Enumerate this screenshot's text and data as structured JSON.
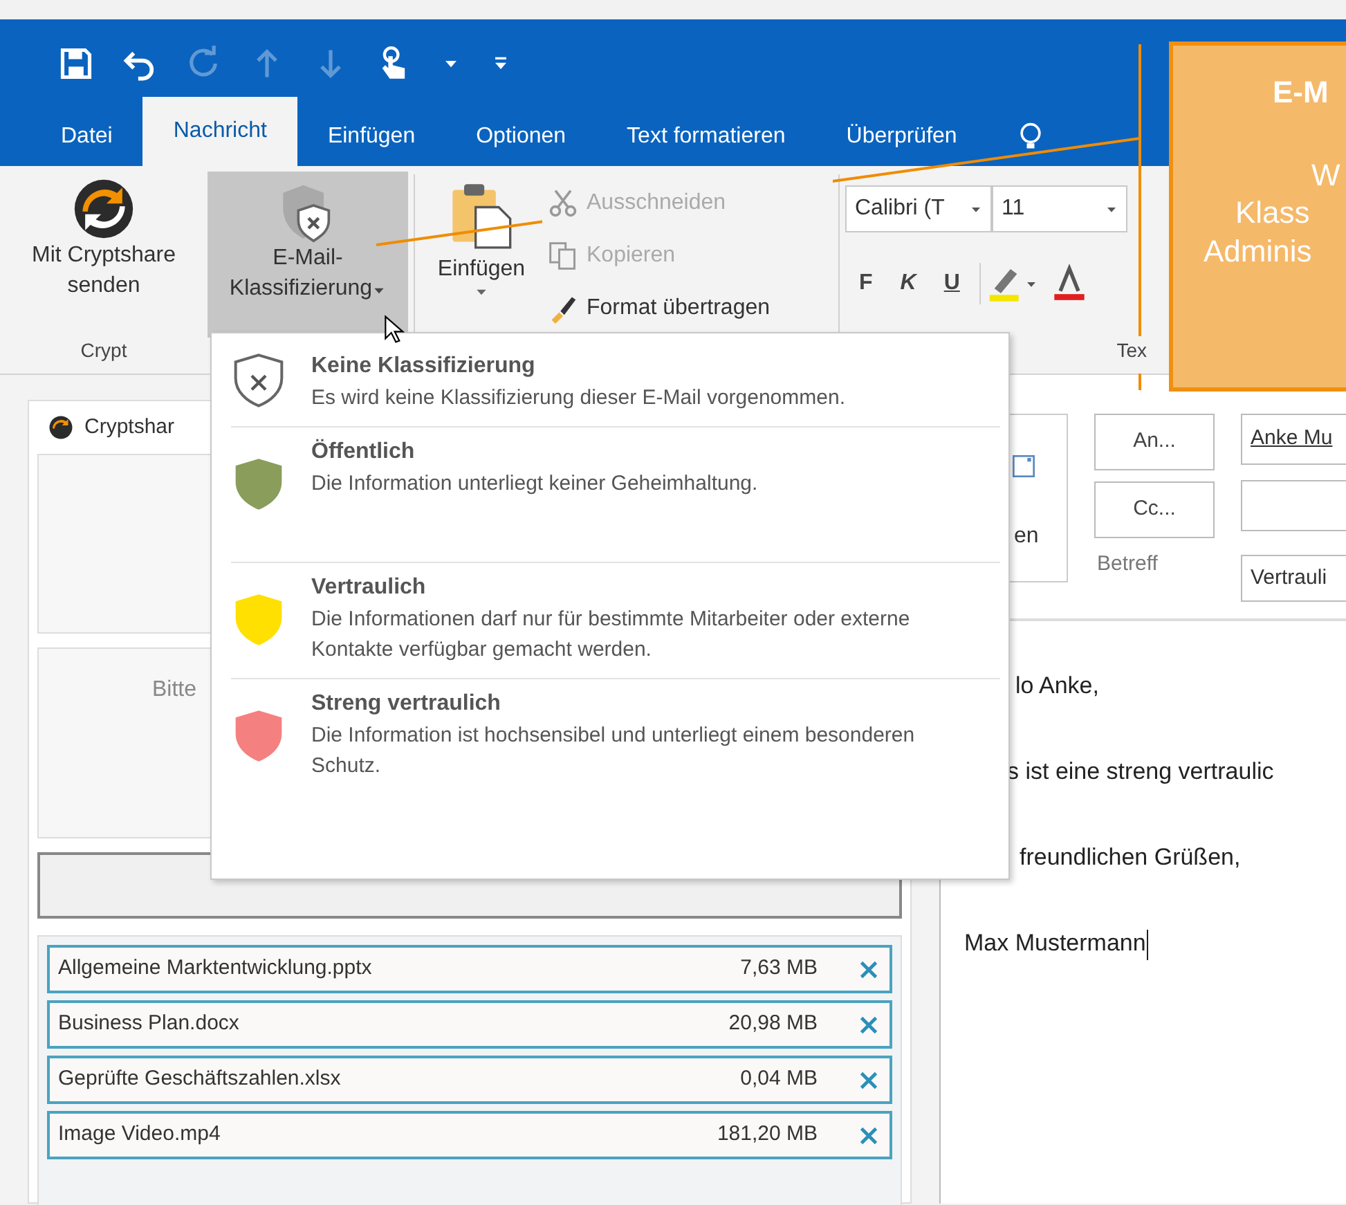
{
  "quick_access": [
    {
      "kind": "save",
      "disabled": false
    },
    {
      "kind": "undo",
      "disabled": false
    },
    {
      "kind": "redo",
      "disabled": true
    },
    {
      "kind": "up",
      "disabled": true
    },
    {
      "kind": "down",
      "disabled": true
    },
    {
      "kind": "touch",
      "disabled": false
    },
    {
      "kind": "caret",
      "disabled": false
    },
    {
      "kind": "customize",
      "disabled": false
    }
  ],
  "tabs": [
    {
      "label": "Datei",
      "selected": false
    },
    {
      "label": "Nachricht",
      "selected": true
    },
    {
      "label": "Einfügen",
      "selected": false
    },
    {
      "label": "Optionen",
      "selected": false
    },
    {
      "label": "Text formatieren",
      "selected": false
    },
    {
      "label": "Überprüfen",
      "selected": false
    }
  ],
  "ribbon": {
    "cryptshare_group": {
      "button_lines": [
        "Mit Cryptshare",
        "senden"
      ],
      "group_label": "Crypt"
    },
    "classification_button": {
      "lines": [
        "E-Mail-",
        "Klassifizierung"
      ],
      "pressed": true
    },
    "paste_button": {
      "label": "Einfügen"
    },
    "clipboard_actions": [
      {
        "kind": "cut",
        "label": "Ausschneiden",
        "disabled": true
      },
      {
        "kind": "copy",
        "label": "Kopieren",
        "disabled": true
      },
      {
        "kind": "brush",
        "label": "Format übertragen",
        "disabled": false
      }
    ],
    "font": {
      "family": "Calibri (T",
      "size": "11",
      "style_buttons": [
        "F",
        "K",
        "U"
      ],
      "group_label": "Tex"
    }
  },
  "cryptshare_panel": {
    "title": "Cryptshar",
    "drop_hint": "Bitte",
    "files": [
      {
        "name": "Allgemeine Marktentwicklung.pptx",
        "size": "7,63 MB"
      },
      {
        "name": "Business Plan.docx",
        "size": "20,98 MB"
      },
      {
        "name": "Geprüfte Geschäftszahlen.xlsx",
        "size": "0,04 MB"
      },
      {
        "name": "Image Video.mp4",
        "size": "181,20 MB"
      }
    ]
  },
  "mail": {
    "send_fragment": "en",
    "to_button": "An...",
    "cc_button": "Cc...",
    "subject_label": "Betreff",
    "to_value": "Anke Mu",
    "subject_value": "Vertrauli",
    "body_lines": [
      "lo Anke,",
      "s ist eine streng vertraulic",
      "freundlichen Grüßen,",
      "Max Mustermann"
    ]
  },
  "classification_menu": [
    {
      "kind": "outline",
      "title": "Keine Klassifizierung",
      "description": "Es wird keine Klassifizierung dieser E-Mail vorgenommen."
    },
    {
      "kind": "filled",
      "color": "#8a9d5b",
      "title": "Öffentlich",
      "description": "Die Information unterliegt keiner Geheimhaltung."
    },
    {
      "kind": "filled",
      "color": "#ffe000",
      "title": "Vertraulich",
      "description": "Die Informationen darf nur für bestimmte Mitarbeiter oder externe Kontakte verfügbar gemacht werden."
    },
    {
      "kind": "filled",
      "color": "#f58080",
      "title": "Streng vertraulich",
      "description": "Die Information ist hochsensibel und unterliegt einem besonderen Schutz."
    }
  ],
  "callout": {
    "lines": [
      "E-M",
      "W",
      "Klass",
      "Adminis"
    ]
  }
}
